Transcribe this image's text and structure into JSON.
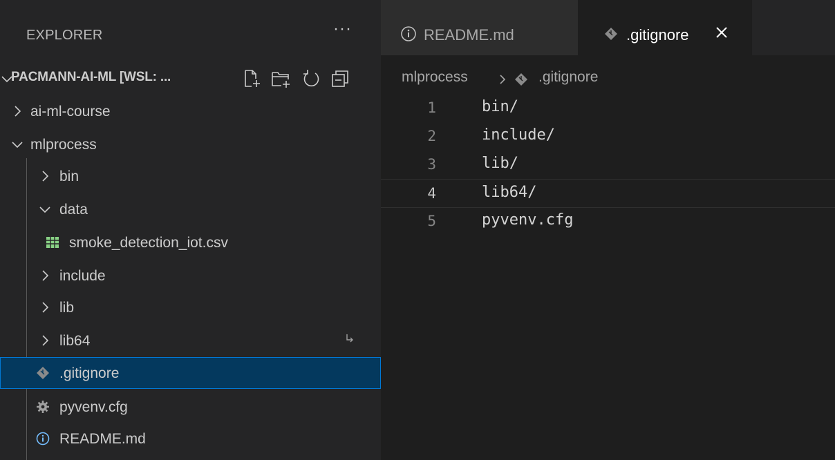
{
  "sidebar": {
    "title": "EXPLORER",
    "more_actions": "···",
    "workspace": {
      "name": "PACMANN-AI-ML [WSL: ..."
    },
    "items": [
      {
        "label": "ai-ml-course",
        "kind": "folder",
        "expanded": false
      },
      {
        "label": "mlprocess",
        "kind": "folder",
        "expanded": true
      },
      {
        "label": "bin",
        "kind": "folder",
        "expanded": false
      },
      {
        "label": "data",
        "kind": "folder",
        "expanded": true
      },
      {
        "label": "smoke_detection_iot.csv",
        "kind": "file",
        "icon": "table-icon"
      },
      {
        "label": "include",
        "kind": "folder",
        "expanded": false
      },
      {
        "label": "lib",
        "kind": "folder",
        "expanded": false
      },
      {
        "label": "lib64",
        "kind": "folder",
        "expanded": false,
        "symlink": true
      },
      {
        "label": ".gitignore",
        "kind": "file",
        "icon": "git-icon",
        "selected": true
      },
      {
        "label": "pyvenv.cfg",
        "kind": "file",
        "icon": "gear-icon"
      },
      {
        "label": "README.md",
        "kind": "file",
        "icon": "info-icon"
      }
    ]
  },
  "tabs": [
    {
      "label": "README.md",
      "icon": "info-icon",
      "active": false
    },
    {
      "label": ".gitignore",
      "icon": "git-icon",
      "active": true
    }
  ],
  "breadcrumb": {
    "folder": "mlprocess",
    "file": ".gitignore"
  },
  "editor": {
    "current_line": 4,
    "lines": [
      {
        "number": "1",
        "text": "bin/"
      },
      {
        "number": "2",
        "text": "include/"
      },
      {
        "number": "3",
        "text": "lib/"
      },
      {
        "number": "4",
        "text": "lib64/"
      },
      {
        "number": "5",
        "text": "pyvenv.cfg"
      }
    ]
  },
  "colors": {
    "sidebar_bg": "#252526",
    "editor_bg": "#1e1e1e",
    "selection_bg": "#04395e",
    "selection_border": "#0078d4",
    "git_icon": "#8a8a8a",
    "csv_icon": "#89d185",
    "info_icon": "#75beff"
  }
}
